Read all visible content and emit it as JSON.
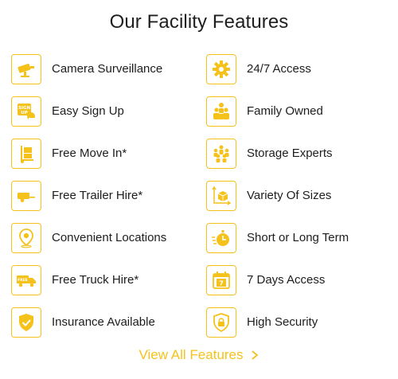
{
  "title": "Our Facility Features",
  "accent_color": "#f5c21b",
  "features": [
    {
      "label": "Camera Surveillance",
      "icon": "camera-icon"
    },
    {
      "label": "24/7 Access",
      "icon": "gear-icon"
    },
    {
      "label": "Easy Sign Up",
      "icon": "sign-up-icon"
    },
    {
      "label": "Family Owned",
      "icon": "family-icon"
    },
    {
      "label": "Free Move In*",
      "icon": "hand-truck-icon"
    },
    {
      "label": "Storage Experts",
      "icon": "team-icon"
    },
    {
      "label": "Free Trailer Hire*",
      "icon": "trailer-icon"
    },
    {
      "label": "Variety Of Sizes",
      "icon": "box-sizes-icon"
    },
    {
      "label": "Convenient Locations",
      "icon": "location-pin-icon"
    },
    {
      "label": "Short or Long Term",
      "icon": "stopwatch-icon"
    },
    {
      "label": "Free Truck Hire*",
      "icon": "truck-icon"
    },
    {
      "label": "7 Days Access",
      "icon": "calendar-icon"
    },
    {
      "label": "Insurance Available",
      "icon": "shield-check-icon"
    },
    {
      "label": "High Security",
      "icon": "shield-lock-icon"
    }
  ],
  "cta": {
    "label": "View All Features"
  }
}
